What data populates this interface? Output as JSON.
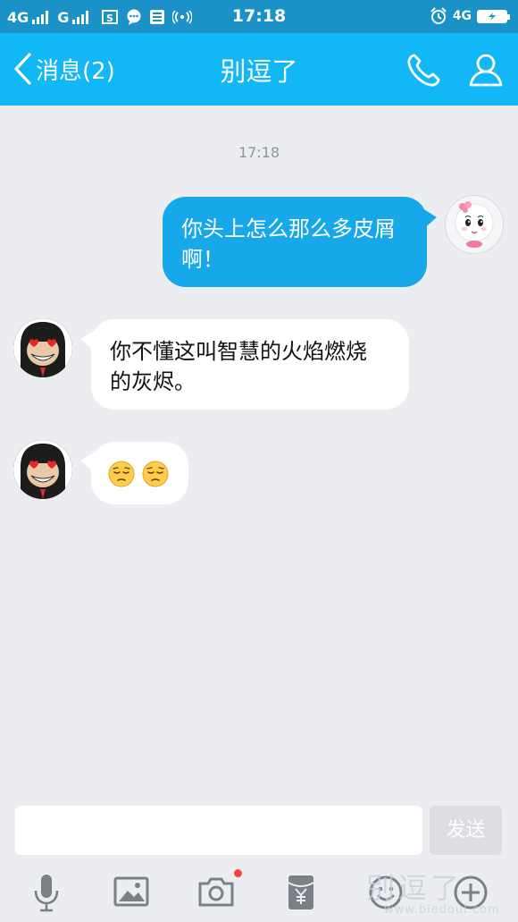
{
  "status_bar": {
    "network_left": "4G",
    "network_right": "G",
    "time": "17:18",
    "network_status": "4G"
  },
  "header": {
    "back_label": "消息(2)",
    "title": "别逗了"
  },
  "chat": {
    "timestamp": "17:18",
    "messages": [
      {
        "direction": "outgoing",
        "line1": "你头上怎么那么多皮屑",
        "line2": "啊！"
      },
      {
        "direction": "incoming",
        "line1": "你不懂这叫智慧的火焰燃烧",
        "line2": "的灰烬。"
      },
      {
        "direction": "incoming",
        "emoji": [
          "pensive-face",
          "pensive-face"
        ]
      }
    ]
  },
  "input": {
    "value": "",
    "send_label": "发送"
  },
  "toolbar": {
    "buttons": [
      "microphone-icon",
      "image-icon",
      "camera-icon",
      "red-packet-icon",
      "smiley-icon",
      "plus-icon"
    ]
  },
  "watermark": {
    "text": "别逗了",
    "url": "www.biedoul.com"
  },
  "colors": {
    "status_bar": "#1a92c8",
    "header": "#12b7f5",
    "outgoing_bubble": "#17a8ea",
    "incoming_bubble": "#ffffff",
    "chat_background": "#ebedf1",
    "notification_dot": "#f4453a"
  }
}
